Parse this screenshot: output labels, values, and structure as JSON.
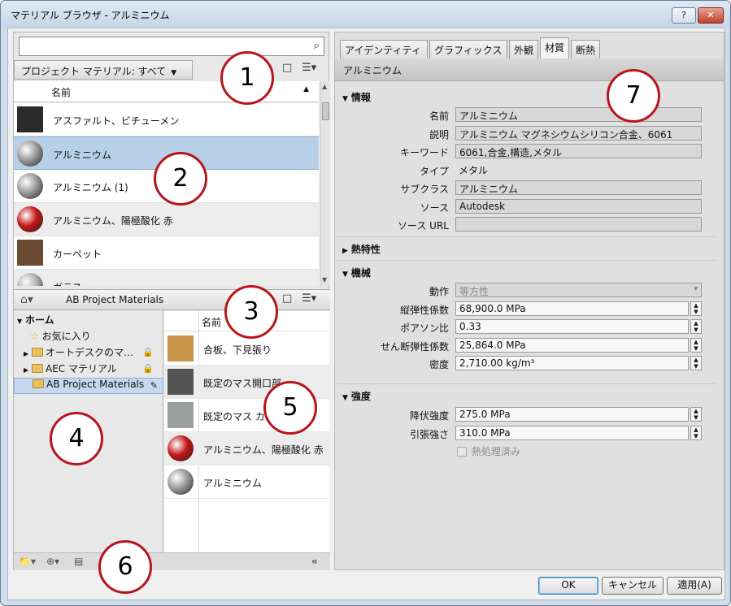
{
  "window": {
    "title": "マテリアル ブラウザ - アルミニウム",
    "help_label": "?",
    "close_label": "✕"
  },
  "search": {
    "placeholder": "",
    "icon": "search-icon"
  },
  "project": {
    "breadcrumb": "プロジェクト マテリアル: すべて",
    "column_name": "名前",
    "materials": [
      {
        "label": "アスファルト、ビチューメン",
        "swatch": "#2b2b2b"
      },
      {
        "label": "アルミニウム",
        "swatch": "#9a9a9a",
        "selected": true
      },
      {
        "label": "アルミニウム (1)",
        "swatch": "#9a9a9a"
      },
      {
        "label": "アルミニウム、陽極酸化 赤",
        "swatch": "#c41515"
      },
      {
        "label": "カーペット",
        "swatch": "#6b4a33"
      },
      {
        "label": "ガラス",
        "swatch": "#b0b0b0"
      }
    ]
  },
  "library": {
    "breadcrumb": "AB Project Materials",
    "tree": [
      {
        "label": "ホーム",
        "type": "home"
      },
      {
        "label": "お気に入り",
        "type": "favorite"
      },
      {
        "label": "オートデスクのマ…",
        "type": "folder",
        "locked": true
      },
      {
        "label": "AEC マテリアル",
        "type": "folder",
        "locked": true
      },
      {
        "label": "AB Project Materials",
        "type": "folder",
        "selected": true
      }
    ],
    "column_name": "名前",
    "items": [
      {
        "label": "合板、下見張り",
        "swatch": "#c8954a"
      },
      {
        "label": "既定のマス開口部",
        "swatch": "#555555"
      },
      {
        "label": "既定のマス カ",
        "swatch": "#9aa0a0"
      },
      {
        "label": "アルミニウム、陽極酸化 赤",
        "swatch": "#c41515"
      },
      {
        "label": "アルミニウム",
        "swatch": "#9a9a9a"
      }
    ]
  },
  "tabs": [
    {
      "label": "アイデンティティ"
    },
    {
      "label": "グラフィックス"
    },
    {
      "label": "外観"
    },
    {
      "label": "材質",
      "active": true
    },
    {
      "label": "断熱"
    }
  ],
  "material_name": "アルミニウム",
  "info": {
    "section": "情報",
    "rows": [
      {
        "label": "名前",
        "value": "アルミニウム"
      },
      {
        "label": "説明",
        "value": "アルミニウム マグネシウムシリコン合金、6061"
      },
      {
        "label": "キーワード",
        "value": "6061,合金,構造,メタル"
      },
      {
        "label": "タイプ",
        "value": "メタル"
      },
      {
        "label": "サブクラス",
        "value": "アルミニウム"
      },
      {
        "label": "ソース",
        "value": "Autodesk"
      },
      {
        "label": "ソース URL",
        "value": ""
      }
    ]
  },
  "thermal": {
    "section": "熱特性"
  },
  "mechanical": {
    "section": "機械",
    "rows": [
      {
        "label": "動作",
        "value": "等方性"
      },
      {
        "label": "縦弾性係数",
        "value": "68,900.0 MPa"
      },
      {
        "label": "ポアソン比",
        "value": "0.33"
      },
      {
        "label": "せん断弾性係数",
        "value": "25,864.0 MPa"
      },
      {
        "label": "密度",
        "value": "2,710.00 kg/m³"
      }
    ]
  },
  "strength": {
    "section": "強度",
    "rows": [
      {
        "label": "降伏強度",
        "value": "275.0 MPa"
      },
      {
        "label": "引張強さ",
        "value": "310.0 MPa"
      }
    ],
    "checkbox_label": "熱処理済み"
  },
  "buttons": {
    "ok": "OK",
    "cancel": "キャンセル",
    "apply": "適用(A)"
  },
  "callouts": [
    "1",
    "2",
    "3",
    "4",
    "5",
    "6",
    "7"
  ]
}
